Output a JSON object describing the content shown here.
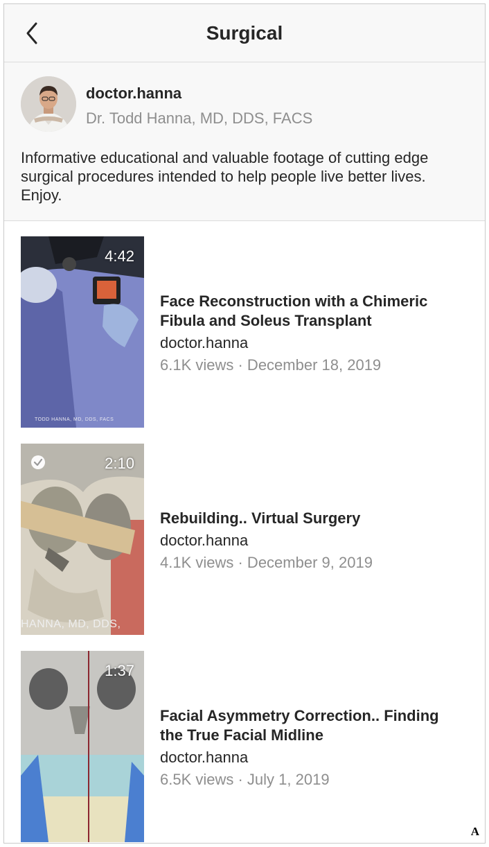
{
  "header": {
    "title": "Surgical",
    "back_icon": "chevron-left-icon"
  },
  "profile": {
    "username": "doctor.hanna",
    "full_name": "Dr. Todd Hanna, MD, DDS, FACS",
    "bio": "Informative educational and valuable footage of cutting edge surgical procedures intended to help people live better lives. Enjoy."
  },
  "videos": [
    {
      "duration": "4:42",
      "title": "Face Reconstruction with a Chimeric Fibula and Soleus Transplant",
      "author": "doctor.hanna",
      "stats": "6.1K views · December 18, 2019",
      "watermark": "TODD HANNA, MD, DDS, FACS"
    },
    {
      "duration": "2:10",
      "title": "Rebuilding.. Virtual Surgery",
      "author": "doctor.hanna",
      "stats": "4.1K views · December 9, 2019",
      "watermark": "HANNA, MD, DDS,",
      "watched_icon": "checkmark-circle-icon"
    },
    {
      "duration": "1:37",
      "title": "Facial Asymmetry Correction.. Finding the True Facial Midline",
      "author": "doctor.hanna",
      "stats": "6.5K views · July 1, 2019"
    }
  ],
  "figure_label": "A"
}
